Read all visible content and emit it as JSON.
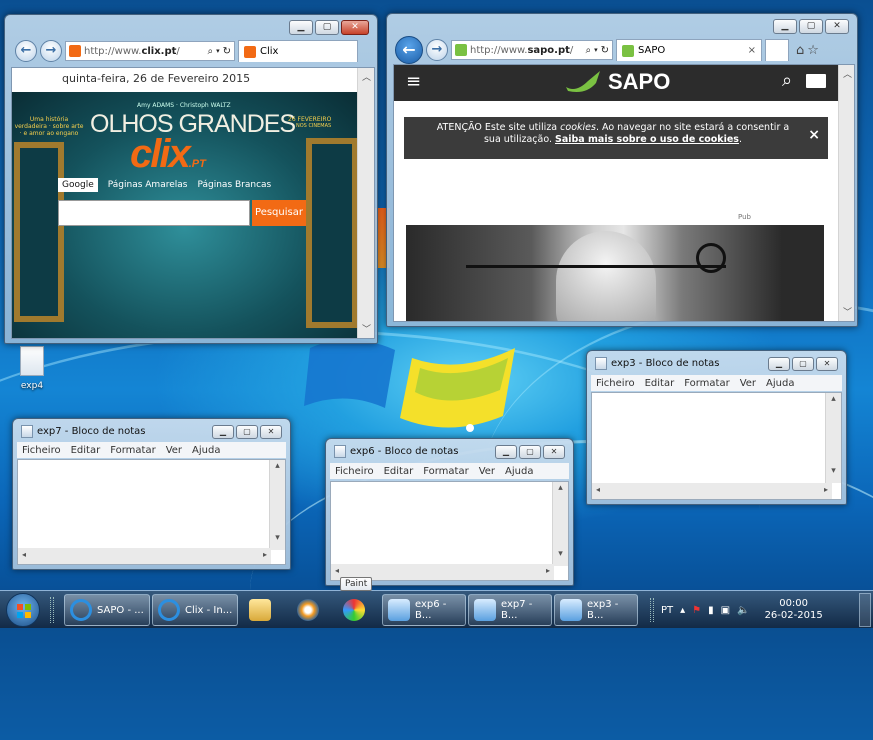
{
  "desktop": {
    "icon_label": "exp4"
  },
  "ie_clix": {
    "url_prefix": "http://www.",
    "url_domain": "clix.pt",
    "url_suffix": "/",
    "tab_label": "Clix",
    "date_text": "quinta-feira, 26 de Fevereiro 2015",
    "banner_small_credit": "Amy ADAMS · Christoph WALTZ",
    "banner_left_tag": "Uma história verdadeira · sobre arte · e amor ao engano",
    "banner_title": "OLHOS GRANDES",
    "banner_date": "26 FEVEREIRO",
    "banner_date_sub": "NOS CINEMAS",
    "logo": "clix",
    "logo_suffix": ".PT",
    "search_tabs": [
      "Google",
      "Páginas Amarelas",
      "Páginas Brancas"
    ],
    "search_value": "",
    "search_button": "Pesquisar"
  },
  "ie_sapo": {
    "url_prefix": "http://www.",
    "url_domain": "sapo.pt",
    "url_suffix": "/",
    "tab_label": "SAPO",
    "tab_close": "×",
    "logo_text": "SAPO",
    "cookie_prefix": "ATENÇÃO Este site utiliza ",
    "cookie_em": "cookies",
    "cookie_mid": ". Ao navegar no site estará a consentir a sua utilização. ",
    "cookie_link": "Saiba mais sobre o uso de cookies",
    "cookie_end": ".",
    "cookie_close": "×",
    "pub_label": "Pub"
  },
  "notepads": [
    {
      "title": "exp3 - Bloco de notas",
      "menu": [
        "Ficheiro",
        "Editar",
        "Formatar",
        "Ver",
        "Ajuda"
      ]
    },
    {
      "title": "exp7 - Bloco de notas",
      "menu": [
        "Ficheiro",
        "Editar",
        "Formatar",
        "Ver",
        "Ajuda"
      ]
    },
    {
      "title": "exp6 - Bloco de notas",
      "menu": [
        "Ficheiro",
        "Editar",
        "Formatar",
        "Ver",
        "Ajuda"
      ]
    }
  ],
  "tooltip": "Paint",
  "taskbar": {
    "items": [
      {
        "label": "SAPO - ..."
      },
      {
        "label": "Clix - In..."
      },
      {
        "label": "exp6 - B..."
      },
      {
        "label": "exp7 - B..."
      },
      {
        "label": "exp3 - B..."
      }
    ],
    "language": "PT",
    "time": "00:00",
    "date": "26-02-2015"
  },
  "colors": {
    "clix_orange": "#f26a14",
    "sapo_green": "#7ac142",
    "sapo_header": "#2c2c2c",
    "ie_blue": "#1b5ea8"
  }
}
